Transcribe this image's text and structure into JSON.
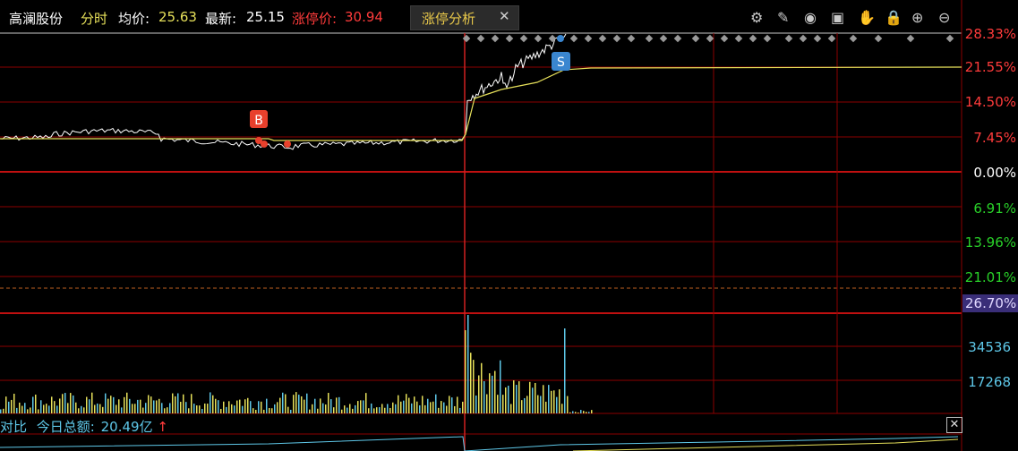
{
  "header": {
    "stock_name": "高澜股份",
    "view_mode": "分时",
    "avg_label": "均价:",
    "avg_value": "25.63",
    "latest_label": "最新:",
    "latest_value": "25.15",
    "limit_label": "涨停价:",
    "limit_value": "30.94"
  },
  "tab": {
    "label": "涨停分析",
    "close": "✕"
  },
  "toolbar": [
    {
      "name": "settings-icon",
      "glyph": "⚙"
    },
    {
      "name": "draw-icon",
      "glyph": "✎"
    },
    {
      "name": "eye-icon",
      "glyph": "◉"
    },
    {
      "name": "box-icon",
      "glyph": "▣"
    },
    {
      "name": "hand-icon",
      "glyph": "✋"
    },
    {
      "name": "lock-icon",
      "glyph": "🔒"
    },
    {
      "name": "zoom-in-icon",
      "glyph": "⊕"
    },
    {
      "name": "zoom-out-icon",
      "glyph": "⊖"
    }
  ],
  "axis_labels": [
    {
      "text": "28.33%",
      "color": "#ff3b3b"
    },
    {
      "text": "21.55%",
      "color": "#ff3b3b"
    },
    {
      "text": "14.50%",
      "color": "#ff3b3b"
    },
    {
      "text": "7.45%",
      "color": "#ff3b3b"
    },
    {
      "text": "0.00%",
      "color": "#ffffff"
    },
    {
      "text": "6.91%",
      "color": "#29d129"
    },
    {
      "text": "13.96%",
      "color": "#29d129"
    },
    {
      "text": "21.01%",
      "color": "#29d129"
    }
  ],
  "volume_axis": {
    "highlight": "26.70%",
    "labels": [
      "34536",
      "17268"
    ]
  },
  "markers": {
    "buy": "B",
    "sell": "S"
  },
  "bottom_bar": {
    "label1": "对比",
    "label2": "今日总额:",
    "value": "20.49亿",
    "arrow": "↑",
    "close": "✕"
  },
  "colors": {
    "grid": "#8b0000",
    "price_line": "#ffffff",
    "avg_line": "#e6e05a",
    "up": "#ff3b3b",
    "down": "#29d129",
    "volume": "#e6e05a",
    "volume_alt": "#5ec7e8",
    "buy_marker": "#e8402c",
    "sell_marker": "#3a86d0"
  }
}
